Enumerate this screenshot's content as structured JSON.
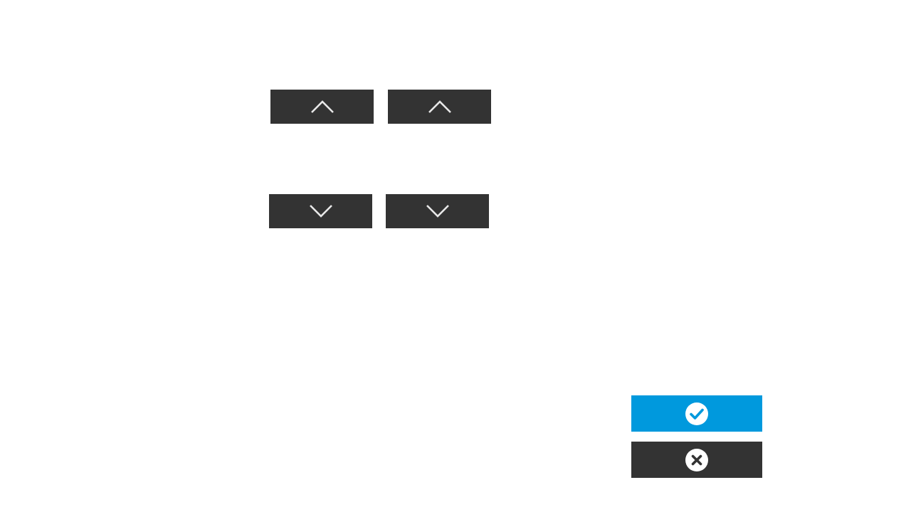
{
  "controls": {
    "increase_buttons": [
      {
        "icon": "chevron-up-icon"
      },
      {
        "icon": "chevron-up-icon"
      }
    ],
    "decrease_buttons": [
      {
        "icon": "chevron-down-icon"
      },
      {
        "icon": "chevron-down-icon"
      }
    ]
  },
  "actions": {
    "confirm": {
      "icon": "checkmark-circle-icon",
      "color": "#0099DD"
    },
    "cancel": {
      "icon": "close-circle-icon",
      "color": "#333333"
    }
  },
  "colors": {
    "background": "#FFFFFF",
    "button_dark": "#333333",
    "icon_light": "#E8E8E8",
    "accent": "#0099DD"
  }
}
